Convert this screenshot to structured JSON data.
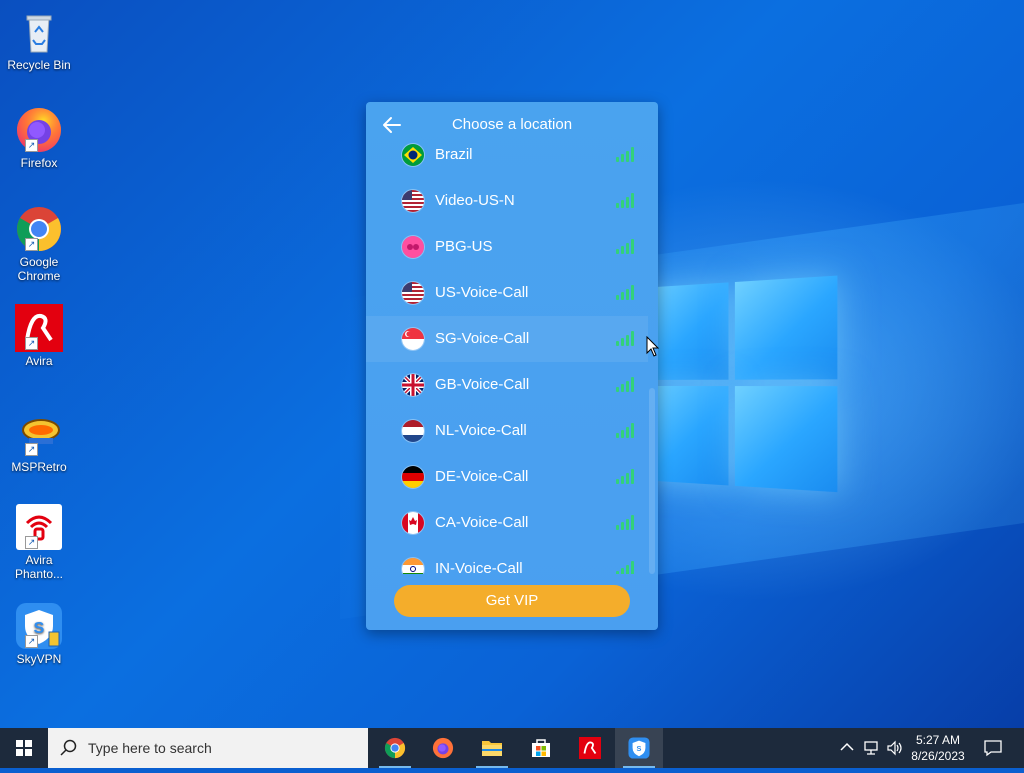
{
  "desktop": {
    "icons": [
      {
        "label": "Recycle Bin",
        "icon": "recycle-bin-icon"
      },
      {
        "label": "Firefox",
        "icon": "firefox-icon"
      },
      {
        "label": "Google Chrome",
        "icon": "chrome-icon"
      },
      {
        "label": "Avira",
        "icon": "avira-icon"
      },
      {
        "label": "MSPRetro",
        "icon": "mspretro-icon"
      },
      {
        "label": "Avira Phanto...",
        "icon": "avira-phantom-icon"
      },
      {
        "label": "SkyVPN",
        "icon": "skyvpn-icon"
      }
    ]
  },
  "vpn_window": {
    "title": "Choose a location",
    "locations": [
      {
        "name": "Brazil",
        "flag": "brazil-flag-icon"
      },
      {
        "name": "Video-US-N",
        "flag": "us-flag-icon"
      },
      {
        "name": "PBG-US",
        "flag": "pbg-flag-icon"
      },
      {
        "name": "US-Voice-Call",
        "flag": "us-flag-icon"
      },
      {
        "name": "SG-Voice-Call",
        "flag": "singapore-flag-icon"
      },
      {
        "name": "GB-Voice-Call",
        "flag": "uk-flag-icon"
      },
      {
        "name": "NL-Voice-Call",
        "flag": "netherlands-flag-icon"
      },
      {
        "name": "DE-Voice-Call",
        "flag": "germany-flag-icon"
      },
      {
        "name": "CA-Voice-Call",
        "flag": "canada-flag-icon"
      },
      {
        "name": "IN-Voice-Call",
        "flag": "india-flag-icon"
      }
    ],
    "vip_button": "Get VIP",
    "signal_color": "#33d17a",
    "accent_color": "#f4ad2b"
  },
  "taskbar": {
    "search_placeholder": "Type here to search",
    "apps": [
      "chrome-icon",
      "firefox-icon",
      "file-explorer-icon",
      "store-icon",
      "avira-icon",
      "skyvpn-icon"
    ],
    "time": "5:27 AM",
    "date": "8/26/2023"
  }
}
